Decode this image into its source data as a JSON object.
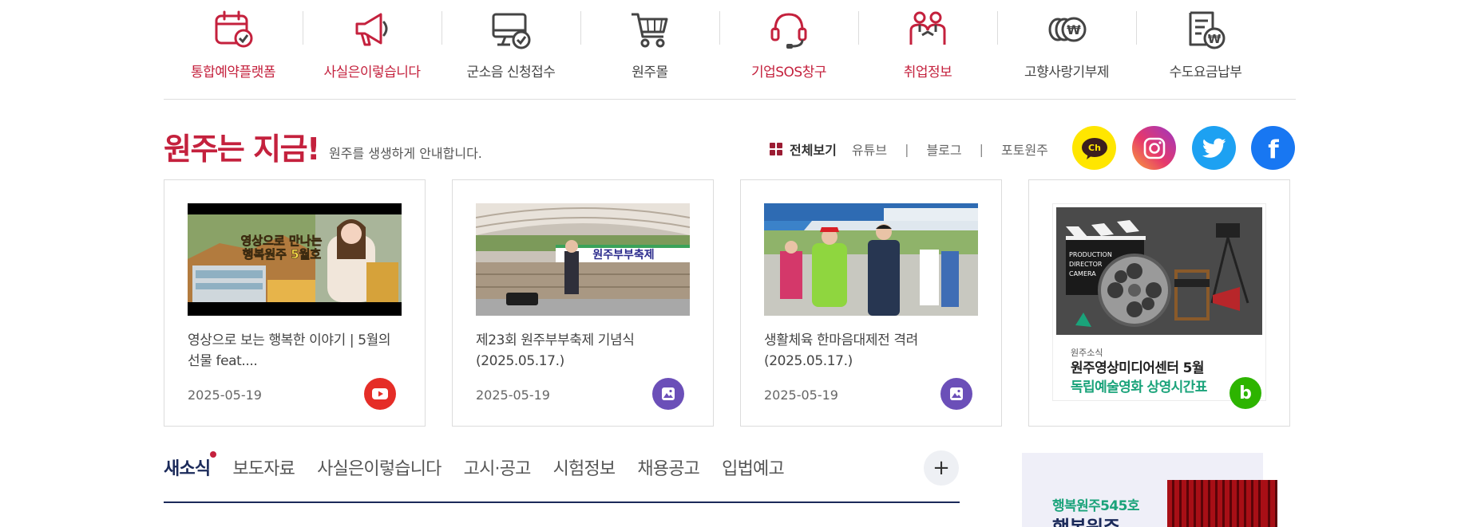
{
  "quick_menu": [
    {
      "label": "통합예약플랫폼",
      "icon": "calendar-check-icon",
      "color": "#c4213d"
    },
    {
      "label": "사실은이렇습니다",
      "icon": "megaphone-icon",
      "color": "#c4213d"
    },
    {
      "label": "군소음 신청접수",
      "icon": "monitor-check-icon",
      "color": "#444444"
    },
    {
      "label": "원주몰",
      "icon": "shopping-cart-icon",
      "color": "#444444"
    },
    {
      "label": "기업SOS창구",
      "icon": "headset-icon",
      "color": "#c4213d"
    },
    {
      "label": "취업정보",
      "icon": "people-icon",
      "color": "#c4213d"
    },
    {
      "label": "고향사랑기부제",
      "icon": "coins-won-icon",
      "color": "#444444"
    },
    {
      "label": "수도요금납부",
      "icon": "bill-won-icon",
      "color": "#444444"
    }
  ],
  "now": {
    "title": "원주는 지금!",
    "subtitle": "원주를 생생하게 안내합니다.",
    "view_all": "전체보기",
    "links": [
      "유튜브",
      "블로그",
      "포토원주"
    ],
    "separator": "|",
    "social": [
      {
        "icon": "kakao-channel-icon",
        "label": "Ch"
      },
      {
        "icon": "instagram-icon"
      },
      {
        "icon": "twitter-icon"
      },
      {
        "icon": "facebook-icon",
        "label": "f"
      }
    ]
  },
  "cards": [
    {
      "title": "영상으로 보는 행복한 이야기 | 5월의 선물 feat....",
      "date": "2025-05-19",
      "type": "youtube",
      "thumb_caption": "영상으로 만나는\n행복원주 5월호"
    },
    {
      "title": "제23회 원주부부축제 기념식 (2025.05.17.)",
      "date": "2025-05-19",
      "type": "photo",
      "thumb_caption": "원주부부축제"
    },
    {
      "title": "생활체육 한마음대제전 격려 (2025.05.17.)",
      "date": "2025-05-19",
      "type": "photo"
    },
    {
      "type": "blog",
      "poster_category": "원주소식",
      "poster_line1": "원주영상미디어센터 5월",
      "poster_line2": "독립예술영화 상영시간표",
      "clapper_text": "PRODUCTION\nDIRECTOR\nCAMERA",
      "blog_letter": "b"
    }
  ],
  "tabs": [
    "새소식",
    "보도자료",
    "사실은이렇습니다",
    "고시·공고",
    "시험정보",
    "채용공고",
    "입법예고"
  ],
  "more_label": "+",
  "magazine": {
    "line1": "행복원주545호",
    "line2": "행복원주"
  }
}
